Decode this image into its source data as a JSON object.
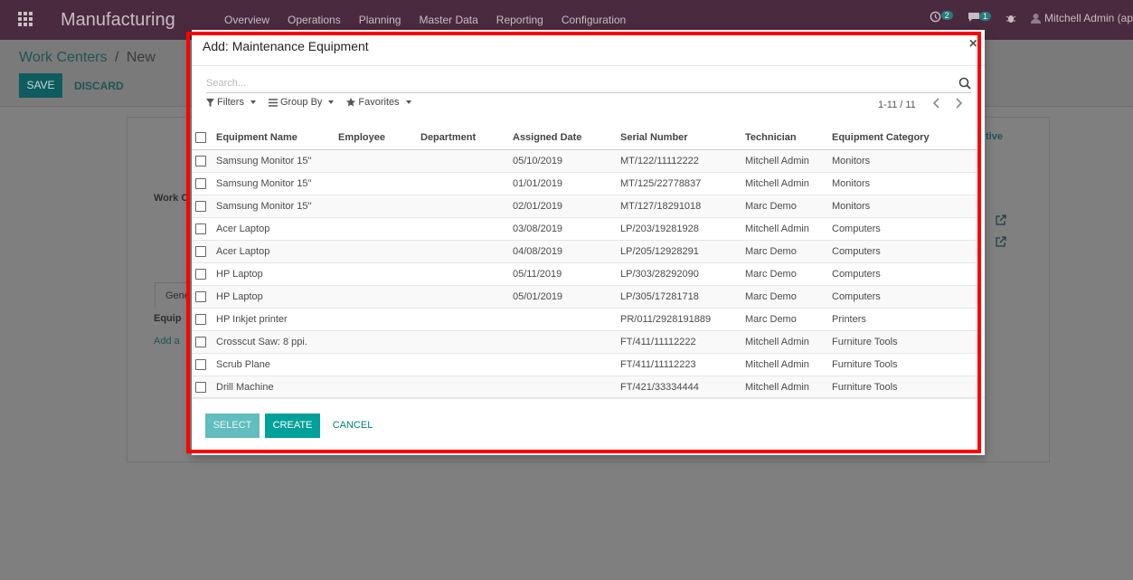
{
  "navbar": {
    "app_title": "Manufacturing",
    "menu": [
      "Overview",
      "Operations",
      "Planning",
      "Master Data",
      "Reporting",
      "Configuration"
    ],
    "activity_count": "2",
    "messages_count": "1",
    "user": "Mitchell Admin (ap"
  },
  "page": {
    "breadcrumb_parent": "Work Centers",
    "breadcrumb_sep": "/",
    "breadcrumb_current": "New",
    "save_label": "SAVE",
    "discard_label": "DISCARD",
    "bg_work_label": "Work C",
    "bg_tab_label": "Gene",
    "bg_equip_label": "Equip",
    "bg_add_label": "Add a",
    "bg_right_label": "tive"
  },
  "modal": {
    "title": "Add: Maintenance Equipment",
    "search_placeholder": "Search...",
    "filters_label": "Filters",
    "groupby_label": "Group By",
    "favorites_label": "Favorites",
    "pager": "1-11 / 11",
    "columns": [
      "Equipment Name",
      "Employee",
      "Department",
      "Assigned Date",
      "Serial Number",
      "Technician",
      "Equipment Category"
    ],
    "rows": [
      {
        "name": "Samsung Monitor 15\"",
        "employee": "",
        "department": "",
        "date": "05/10/2019",
        "serial": "MT/122/11112222",
        "technician": "Mitchell Admin",
        "category": "Monitors"
      },
      {
        "name": "Samsung Monitor 15\"",
        "employee": "",
        "department": "",
        "date": "01/01/2019",
        "serial": "MT/125/22778837",
        "technician": "Mitchell Admin",
        "category": "Monitors"
      },
      {
        "name": "Samsung Monitor 15\"",
        "employee": "",
        "department": "",
        "date": "02/01/2019",
        "serial": "MT/127/18291018",
        "technician": "Marc Demo",
        "category": "Monitors"
      },
      {
        "name": "Acer Laptop",
        "employee": "",
        "department": "",
        "date": "03/08/2019",
        "serial": "LP/203/19281928",
        "technician": "Mitchell Admin",
        "category": "Computers"
      },
      {
        "name": "Acer Laptop",
        "employee": "",
        "department": "",
        "date": "04/08/2019",
        "serial": "LP/205/12928291",
        "technician": "Marc Demo",
        "category": "Computers"
      },
      {
        "name": "HP Laptop",
        "employee": "",
        "department": "",
        "date": "05/11/2019",
        "serial": "LP/303/28292090",
        "technician": "Marc Demo",
        "category": "Computers"
      },
      {
        "name": "HP Laptop",
        "employee": "",
        "department": "",
        "date": "05/01/2019",
        "serial": "LP/305/17281718",
        "technician": "Marc Demo",
        "category": "Computers"
      },
      {
        "name": "HP Inkjet printer",
        "employee": "",
        "department": "",
        "date": "",
        "serial": "PR/011/2928191889",
        "technician": "Marc Demo",
        "category": "Printers"
      },
      {
        "name": "Crosscut Saw: 8 ppi.",
        "employee": "",
        "department": "",
        "date": "",
        "serial": "FT/411/11112222",
        "technician": "Mitchell Admin",
        "category": "Furniture Tools"
      },
      {
        "name": "Scrub Plane",
        "employee": "",
        "department": "",
        "date": "",
        "serial": "FT/411/11112223",
        "technician": "Mitchell Admin",
        "category": "Furniture Tools"
      },
      {
        "name": "Drill Machine",
        "employee": "",
        "department": "",
        "date": "",
        "serial": "FT/421/33334444",
        "technician": "Mitchell Admin",
        "category": "Furniture Tools"
      }
    ],
    "select_label": "SELECT",
    "create_label": "CREATE",
    "cancel_label": "CANCEL",
    "close_glyph": "×"
  },
  "colors": {
    "navbar": "#4a2a3f",
    "primary": "#01a09b",
    "highlight": "#ff0000"
  }
}
